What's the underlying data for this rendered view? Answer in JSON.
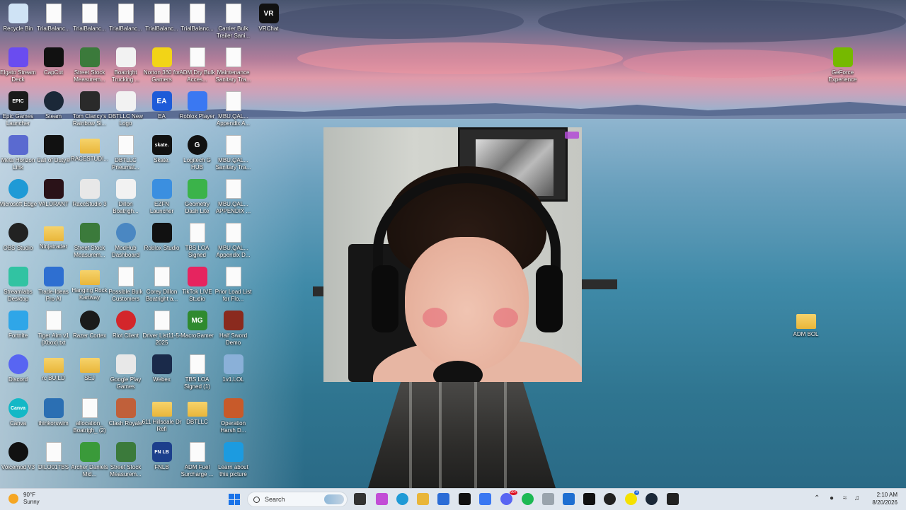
{
  "desktop_icons": [
    {
      "label": "Recycle Bin",
      "icon": "recycle-bin-icon",
      "color": "#cfe3f5"
    },
    {
      "label": "TrialBalanc...",
      "icon": "document-icon"
    },
    {
      "label": "TrialBalanc...",
      "icon": "document-icon"
    },
    {
      "label": "TrialBalanc...",
      "icon": "document-icon"
    },
    {
      "label": "TrialBalanc...",
      "icon": "document-icon"
    },
    {
      "label": "TrialBalanc...",
      "icon": "document-icon"
    },
    {
      "label": "Carrier Bulk Trailer Sani...",
      "icon": "document-icon"
    },
    {
      "label": "VRChat",
      "icon": "vrchat-icon",
      "color": "#111111",
      "text": "VR"
    },
    {
      "label": "Elgato Stream Deck",
      "icon": "stream-deck-icon",
      "color": "#6a4cf0"
    },
    {
      "label": "CapCut",
      "icon": "capcut-icon",
      "color": "#111111"
    },
    {
      "label": "Street Stock Measurem...",
      "icon": "spreadsheet-icon",
      "color": "#3b7a3b"
    },
    {
      "label": "Boatright Trucking ...",
      "icon": "logo-icon",
      "color": "#f2f2f2"
    },
    {
      "label": "Norton 360 for Gamers",
      "icon": "norton-icon",
      "color": "#f2d417"
    },
    {
      "label": "ADM Dry Bulk Acces...",
      "icon": "document-icon"
    },
    {
      "label": "Maintenance Sanitary Tra...",
      "icon": "document-icon"
    },
    {
      "label": "GeForce Experience",
      "icon": "geforce-icon",
      "color": "#76b900"
    },
    {
      "label": "Epic Games Launcher",
      "icon": "epic-games-icon",
      "color": "#1b1b1b",
      "text": "EPIC"
    },
    {
      "label": "Steam",
      "icon": "steam-icon",
      "color": "#1b2838"
    },
    {
      "label": "Tom Clancy's Rainbow Si...",
      "icon": "rainbow-six-icon",
      "color": "#2a2a2a"
    },
    {
      "label": "DBTLLC New Logo",
      "icon": "logo-icon",
      "color": "#f2f2f2"
    },
    {
      "label": "EA",
      "icon": "ea-icon",
      "color": "#1e5bd8",
      "text": "EA"
    },
    {
      "label": "Roblox Player",
      "icon": "roblox-icon",
      "color": "#3a78f2"
    },
    {
      "label": "MBU.QAL... Appendix A...",
      "icon": "document-icon"
    },
    {
      "label": "Meta Horizon Link",
      "icon": "meta-horizon-icon",
      "color": "#5a6ad0"
    },
    {
      "label": "Call of Duty®",
      "icon": "call-of-duty-icon",
      "color": "#111111"
    },
    {
      "label": "RACESTUDI...",
      "icon": "folder-icon"
    },
    {
      "label": "DBTLLC Pneumat...",
      "icon": "document-icon"
    },
    {
      "label": "Skate.",
      "icon": "skate-icon",
      "color": "#111111",
      "text": "skate."
    },
    {
      "label": "Logitech G HUB",
      "icon": "logitech-icon",
      "color": "#111111",
      "text": "G"
    },
    {
      "label": "MBU.QAL... Sanitary Tra...",
      "icon": "document-icon"
    },
    {
      "label": "Microsoft Edge",
      "icon": "edge-icon",
      "color": "#1f9ad6"
    },
    {
      "label": "VALORANT",
      "icon": "valorant-icon",
      "color": "#2a1218"
    },
    {
      "label": "RaceStudio 3",
      "icon": "racestudio-icon",
      "color": "#e8e8e8"
    },
    {
      "label": "Dillon Boatrigh...",
      "icon": "logo-icon",
      "color": "#f2f2f2"
    },
    {
      "label": "EZFN Launcher",
      "icon": "ezfn-icon",
      "color": "#3b8fe0"
    },
    {
      "label": "Geometry Dash Lite",
      "icon": "geometry-dash-icon",
      "color": "#3bb34a"
    },
    {
      "label": "MBU.QAL... APPENDIX ...",
      "icon": "document-icon"
    },
    {
      "label": "OBS Studio",
      "icon": "obs-icon",
      "color": "#222222"
    },
    {
      "label": "Ninjatrader",
      "icon": "folder-icon"
    },
    {
      "label": "Street Stock Measurem...",
      "icon": "spreadsheet-icon",
      "color": "#3b7a3b"
    },
    {
      "label": "ModHub Dashboard",
      "icon": "globe-icon",
      "color": "#4a87c2"
    },
    {
      "label": "Roblox Studio",
      "icon": "roblox-studio-icon",
      "color": "#111111"
    },
    {
      "label": "TBS LOA Signed",
      "icon": "document-icon"
    },
    {
      "label": "MBU.QAL... Appendix D...",
      "icon": "document-icon"
    },
    {
      "label": "Streamlabs Desktop",
      "icon": "streamlabs-icon",
      "color": "#31c3a2"
    },
    {
      "label": "Trade-Ideas Pro AI",
      "icon": "trade-ideas-icon",
      "color": "#2e6fd1"
    },
    {
      "label": "Hanging Rock Kartway",
      "icon": "folder-icon"
    },
    {
      "label": "Possible Bulk Customers",
      "icon": "document-icon"
    },
    {
      "label": "Corey Dillon Boatright a...",
      "icon": "document-icon"
    },
    {
      "label": "TikTok LIVE Studio",
      "icon": "tiktok-icon",
      "color": "#e6245f"
    },
    {
      "label": "Prior Load List for Flo...",
      "icon": "document-icon"
    },
    {
      "label": "Fortnite",
      "icon": "fortnite-icon",
      "color": "#2fa6e8"
    },
    {
      "label": "Tiger Aim v1 (Xbox).txt",
      "icon": "document-icon"
    },
    {
      "label": "Razer Cortex",
      "icon": "razer-icon",
      "color": "#1a1a1a"
    },
    {
      "label": "Riot Client",
      "icon": "riot-icon",
      "color": "#d3262b"
    },
    {
      "label": "Driver List11-5-2025",
      "icon": "document-icon"
    },
    {
      "label": "MacroGamer",
      "icon": "macrogamer-icon",
      "color": "#2f8a2f",
      "text": "MG"
    },
    {
      "label": "Half Sword Demo",
      "icon": "half-sword-icon",
      "color": "#8a2a1e"
    },
    {
      "label": "Discord",
      "icon": "discord-icon",
      "color": "#5865f2"
    },
    {
      "label": "rc BUILD",
      "icon": "folder-icon"
    },
    {
      "label": "SEJ",
      "icon": "folder-icon"
    },
    {
      "label": "Google Play Games",
      "icon": "google-play-icon",
      "color": "#e8e8e8"
    },
    {
      "label": "Webex",
      "icon": "webex-icon",
      "color": "#1a2a4a"
    },
    {
      "label": "TBS LOA Signed (1)",
      "icon": "document-icon"
    },
    {
      "label": "1v1.LOL",
      "icon": "one-v-one-icon",
      "color": "#8ab0d8"
    },
    {
      "label": "Canva",
      "icon": "canva-icon",
      "color": "#13b8c6",
      "text": "Canva"
    },
    {
      "label": "thinkorswim",
      "icon": "thinkorswim-icon",
      "color": "#2b6fb3"
    },
    {
      "label": "allocation_ Boatrigh_ (2)",
      "icon": "document-icon"
    },
    {
      "label": "Clash Royale",
      "icon": "clash-royale-icon",
      "color": "#c0603a"
    },
    {
      "label": "611 Hillsdale Dr Refi",
      "icon": "folder-icon"
    },
    {
      "label": "DBTLLC",
      "icon": "folder-icon"
    },
    {
      "label": "Operation Harsh D...",
      "icon": "operation-harsh-icon",
      "color": "#c85a2a"
    },
    {
      "label": "Voicemod V3",
      "icon": "voicemod-icon",
      "color": "#111111"
    },
    {
      "label": "DILO01TBS",
      "icon": "document-icon"
    },
    {
      "label": "Archer Daniels Mid...",
      "icon": "archer-icon",
      "color": "#3a9a3a"
    },
    {
      "label": "Street Stock Measurem...",
      "icon": "spreadsheet-icon",
      "color": "#3b7a3b"
    },
    {
      "label": "FNLB",
      "icon": "fnlb-icon",
      "color": "#1c3f8c",
      "text": "FN LB"
    },
    {
      "label": "ADM Fuel Surcharge ...",
      "icon": "document-icon"
    },
    {
      "label": "Learn about this picture",
      "icon": "spotlight-icon",
      "color": "#1c9be0"
    },
    {
      "label": "ADM BOL",
      "icon": "folder-icon"
    }
  ],
  "webcam": {
    "badge_color": "#b24bd6"
  },
  "taskbar": {
    "weather": {
      "temp": "90°F",
      "condition": "Sunny"
    },
    "search_placeholder": "Search",
    "pinned": [
      {
        "name": "file-explorer-button-icon",
        "color": "#333333"
      },
      {
        "name": "copilot-icon",
        "color": "#c24dd6"
      },
      {
        "name": "edge-taskbar-icon",
        "color": "#1f9ad6"
      },
      {
        "name": "folder-taskbar-icon",
        "color": "#e9b63a"
      },
      {
        "name": "store-taskbar-icon",
        "color": "#2b6cd6"
      },
      {
        "name": "tiktok-taskbar-icon",
        "color": "#111111"
      },
      {
        "name": "roblox-taskbar-icon",
        "color": "#3a78f2"
      },
      {
        "name": "discord-taskbar-icon",
        "color": "#5865f2"
      },
      {
        "name": "spotify-taskbar-icon",
        "color": "#1db954"
      },
      {
        "name": "notepad-taskbar-icon",
        "color": "#9aa4ad"
      },
      {
        "name": "outlook-taskbar-icon",
        "color": "#1f6fd1"
      },
      {
        "name": "voicemod-taskbar-icon",
        "color": "#111111"
      },
      {
        "name": "obs-taskbar-icon",
        "color": "#222222"
      },
      {
        "name": "snapchat-taskbar-icon",
        "color": "#f5e100"
      },
      {
        "name": "steam-taskbar-icon",
        "color": "#1b2838"
      },
      {
        "name": "app-taskbar-icon",
        "color": "#222222"
      }
    ],
    "badges": {
      "discord": "99+",
      "snapchat": "3"
    },
    "clock": {
      "time": "2:10 AM",
      "date": "8/20/2026"
    }
  }
}
